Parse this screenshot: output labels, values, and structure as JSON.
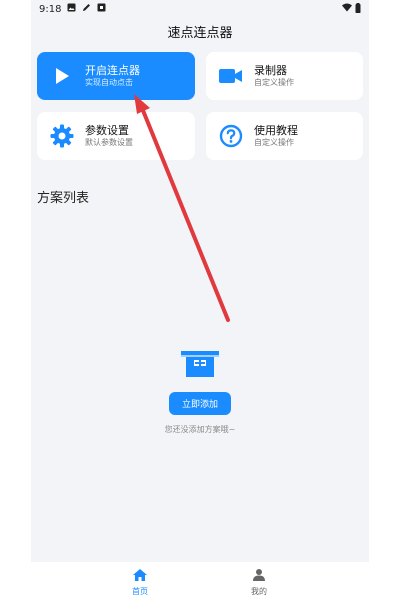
{
  "status_bar": {
    "time": "9:18",
    "icons": [
      "gallery-icon",
      "pen-icon",
      "notification-icon",
      "wifi-icon",
      "battery-icon"
    ]
  },
  "app": {
    "title": "速点连点器"
  },
  "cards": [
    {
      "title": "开启连点器",
      "subtitle": "实现自动点击",
      "icon": "play-icon"
    },
    {
      "title": "录制器",
      "subtitle": "自定义操作",
      "icon": "video-camera-icon"
    },
    {
      "title": "参数设置",
      "subtitle": "默认参数设置",
      "icon": "gear-icon"
    },
    {
      "title": "使用教程",
      "subtitle": "自定义操作",
      "icon": "question-circle-icon"
    }
  ],
  "scheme_list": {
    "title": "方案列表",
    "empty_icon": "empty-box-icon",
    "add_button": "立即添加",
    "empty_text": "您还没添加方案哦~"
  },
  "bottom_nav": {
    "items": [
      {
        "label": "首页",
        "icon": "home-icon",
        "active": true
      },
      {
        "label": "我的",
        "icon": "user-icon",
        "active": false
      }
    ]
  },
  "colors": {
    "accent": "#1a8cff",
    "background": "#f3f4f7",
    "arrow": "#e0393e"
  }
}
